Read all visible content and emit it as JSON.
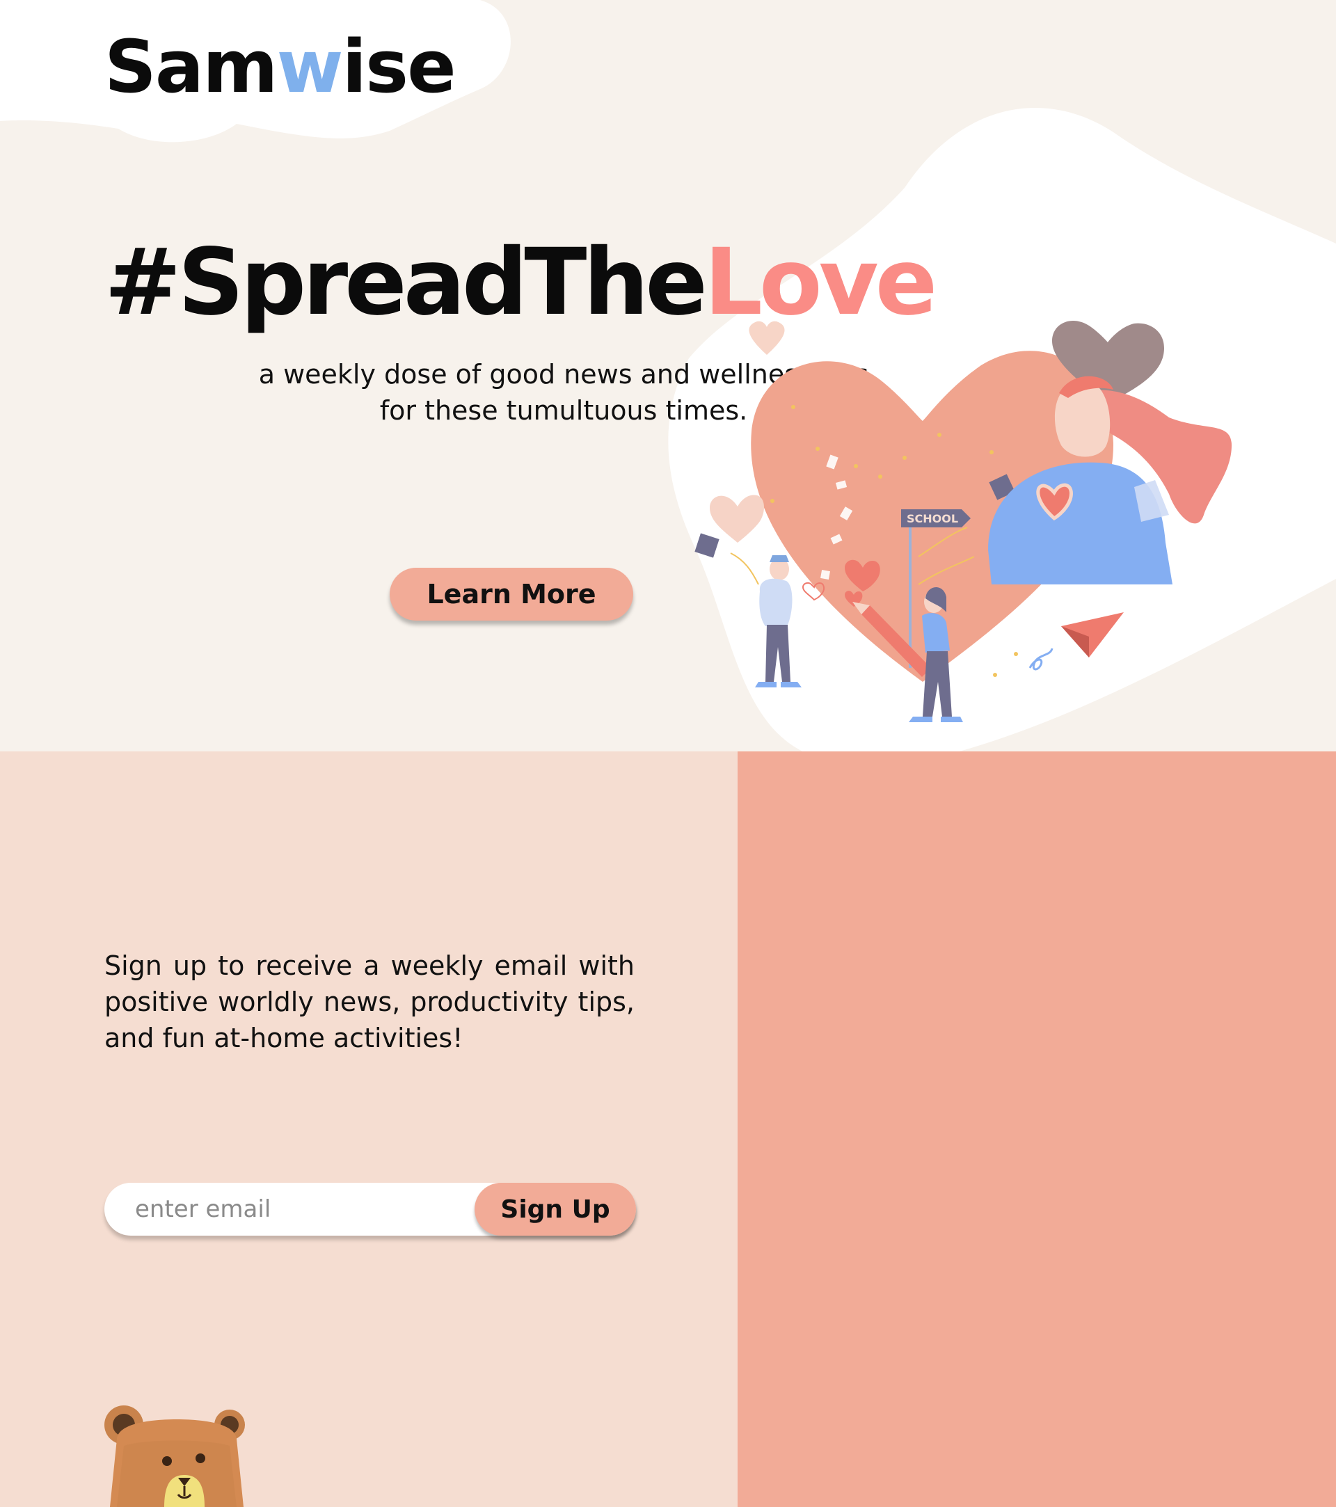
{
  "brand": {
    "logo_prefix": "Sam",
    "logo_accent": "w",
    "logo_suffix": "ise"
  },
  "hero": {
    "headline_main": "#SpreadThe",
    "headline_accent": "Love",
    "tagline_line1": "a weekly dose of good news and wellness tips",
    "tagline_line2": "for these tumultuous times.",
    "cta_label": "Learn More",
    "illustration_sign_text": "SCHOOL"
  },
  "signup": {
    "description": "Sign up to receive a weekly email with positive worldly news, productivity tips, and fun at-home activities!",
    "email_placeholder": "enter email",
    "email_value": "",
    "button_label": "Sign Up"
  },
  "colors": {
    "hero_bg": "#f7f2ec",
    "blob": "#ffffff",
    "accent_pink": "#fa8c86",
    "button_peach": "#f2ab97",
    "logo_blue": "#7fb0ec",
    "left_panel_bg": "#f5ddd1",
    "right_panel_bg": "#f2ab97"
  },
  "icons": {
    "hero_illustration": "heart-people-illustration",
    "mascot": "bear-mascot-icon"
  }
}
